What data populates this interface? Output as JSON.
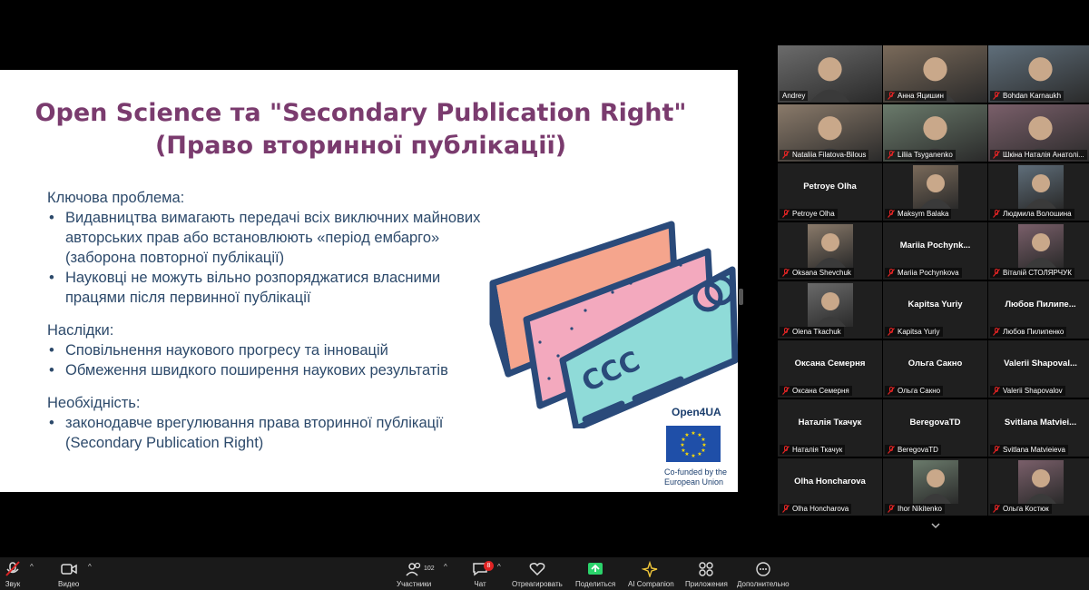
{
  "slide": {
    "title_line1": "Open Science та \"Secondary Publication Right\"",
    "title_line2": "(Право вторинної публікації)",
    "sections": [
      {
        "heading": "Ключова проблема:",
        "bullets": [
          "Видавництва вимагають передачі всіх виключних майнових авторських прав або встановлюють «період ембарго» (заборона повторної публікації)",
          "Науковці не можуть вільно розпоряджатися власними працями після первинної публікації"
        ]
      },
      {
        "heading": "Наслідки:",
        "bullets": [
          "Сповільнення наукового прогресу та інновацій",
          "Обмеження швидкого поширення наукових результатів"
        ]
      },
      {
        "heading": "Необхідність:",
        "bullets": [
          "законодавче врегулювання права вторинної публікації (Secondary Publication Right)"
        ]
      }
    ],
    "card_label": "CCC",
    "eu_title": "Open4UA",
    "eu_caption": "Co-funded by the European Union",
    "colors": {
      "title": "#7a3b6e",
      "body": "#2d4a6b"
    }
  },
  "gallery": [
    {
      "name": "Andrey",
      "display": "",
      "video": true,
      "active": true,
      "muted": false
    },
    {
      "name": "Анна Яцишин",
      "display": "",
      "video": true,
      "active": false,
      "muted": true
    },
    {
      "name": "Bohdan Karnaukh",
      "display": "",
      "video": true,
      "active": false,
      "muted": true
    },
    {
      "name": "Nataliia Filatova-Bilous",
      "display": "",
      "video": true,
      "active": false,
      "muted": true
    },
    {
      "name": "Liliia Tsyganenko",
      "display": "",
      "video": true,
      "active": false,
      "muted": true
    },
    {
      "name": "Шкіна Наталія Анатолі...",
      "display": "",
      "video": true,
      "active": false,
      "muted": true
    },
    {
      "name": "Petroye Olha",
      "display": "Petroye Olha",
      "video": false,
      "photo": false,
      "muted": true
    },
    {
      "name": "Maksym Balaka",
      "display": "",
      "video": false,
      "photo": true,
      "muted": true
    },
    {
      "name": "Людмила Волошина",
      "display": "",
      "video": false,
      "photo": true,
      "muted": true
    },
    {
      "name": "Oksana Shevchuk",
      "display": "",
      "video": false,
      "photo": true,
      "muted": true
    },
    {
      "name": "Mariia Pochynkova",
      "display": "Mariia  Pochynk...",
      "video": false,
      "photo": false,
      "muted": true
    },
    {
      "name": "Віталій СТОЛЯРЧУК",
      "display": "",
      "video": false,
      "photo": true,
      "muted": true
    },
    {
      "name": "Olena Tkachuk",
      "display": "",
      "video": false,
      "photo": true,
      "muted": true
    },
    {
      "name": "Kapitsa Yuriy",
      "display": "Kapitsa Yuriy",
      "video": false,
      "photo": false,
      "muted": true
    },
    {
      "name": "Любов Пилипенко",
      "display": "Любов  Пилипе...",
      "video": false,
      "photo": false,
      "muted": true
    },
    {
      "name": "Оксана Семерня",
      "display": "Оксана Семерня",
      "video": false,
      "photo": false,
      "muted": true
    },
    {
      "name": "Ольга Сакно",
      "display": "Ольга Сакно",
      "video": false,
      "photo": false,
      "muted": true
    },
    {
      "name": "Valerii Shapovalov",
      "display": "Valerii  Shapoval...",
      "video": false,
      "photo": false,
      "muted": true
    },
    {
      "name": "Наталія Ткачук",
      "display": "Наталія Ткачук",
      "video": false,
      "photo": false,
      "muted": true
    },
    {
      "name": "BeregovaTD",
      "display": "BeregovaTD",
      "video": false,
      "photo": false,
      "muted": true
    },
    {
      "name": "Svitlana Matvieieva",
      "display": "Svitlana  Matviei...",
      "video": false,
      "photo": false,
      "muted": true
    },
    {
      "name": "Olha Honcharova",
      "display": "Olha Honcharova",
      "video": false,
      "photo": false,
      "muted": true
    },
    {
      "name": "Ihor Nikitenko",
      "display": "",
      "video": false,
      "photo": true,
      "muted": true
    },
    {
      "name": "Ольга Костюк",
      "display": "",
      "video": false,
      "photo": true,
      "muted": true
    }
  ],
  "toolbar": {
    "audio": "Звук",
    "video": "Видео",
    "participants": "Участники",
    "participants_count": "102",
    "chat": "Чат",
    "chat_badge": "8",
    "react": "Отреагировать",
    "share": "Поделиться",
    "ai": "AI Companion",
    "apps": "Приложения",
    "more": "Дополнительно"
  }
}
